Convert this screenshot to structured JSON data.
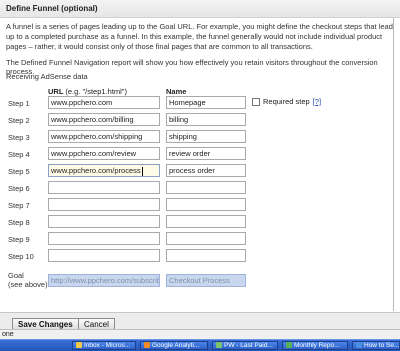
{
  "header": {
    "title": "Define Funnel (optional)"
  },
  "intro": "A funnel is a series of pages leading up to the Goal URL. For example, you might define the checkout steps that lead up to a completed purchase as a funnel. In this example, the funnel generally would not include individual product pages – rather, it would consist only of those final pages that are common to all transactions.",
  "nav_note": "The Defined Funnel Navigation report will show you how effectively you retain visitors throughout the conversion process.",
  "section_title": "Receiving AdSense data",
  "columns": {
    "url": "URL",
    "url_hint": "(e.g. \"/step1.html\")",
    "name": "Name"
  },
  "steps": [
    {
      "label": "Step 1",
      "url": "www.ppchero.com",
      "name": "Homepage"
    },
    {
      "label": "Step 2",
      "url": "www.ppchero.com/billing",
      "name": "billing"
    },
    {
      "label": "Step 3",
      "url": "www.ppchero.com/shipping",
      "name": "shipping"
    },
    {
      "label": "Step 4",
      "url": "www.ppchero.com/review",
      "name": "review order"
    },
    {
      "label": "Step 5",
      "url": "www.ppchero.com/process",
      "name": "process order"
    },
    {
      "label": "Step 6",
      "url": "",
      "name": ""
    },
    {
      "label": "Step 7",
      "url": "",
      "name": ""
    },
    {
      "label": "Step 8",
      "url": "",
      "name": ""
    },
    {
      "label": "Step 9",
      "url": "",
      "name": ""
    },
    {
      "label": "Step 10",
      "url": "",
      "name": ""
    }
  ],
  "required_step": {
    "label": "Required step",
    "help": "[?]",
    "checked": false
  },
  "goal": {
    "label_line1": "Goal",
    "label_line2": "(see above)",
    "url": "http://www.ppchero.com/subscribe",
    "name": "Checkout Process"
  },
  "buttons": {
    "save": "Save Changes",
    "cancel": "Cancel"
  },
  "status_text": "one",
  "taskbar": [
    {
      "label": "Inbox - Micros...",
      "icon": "mail-icon",
      "color": "#f2c94c"
    },
    {
      "label": "Google Analyti...",
      "icon": "browser-icon",
      "color": "#f08a24"
    },
    {
      "label": "PW - Last Paid...",
      "icon": "document-icon",
      "color": "#7cc26b"
    },
    {
      "label": "Monthly Repo...",
      "icon": "spreadsheet-icon",
      "color": "#5bb15a"
    },
    {
      "label": "How to Se...",
      "icon": "document-icon",
      "color": "#4f8fe0"
    }
  ]
}
